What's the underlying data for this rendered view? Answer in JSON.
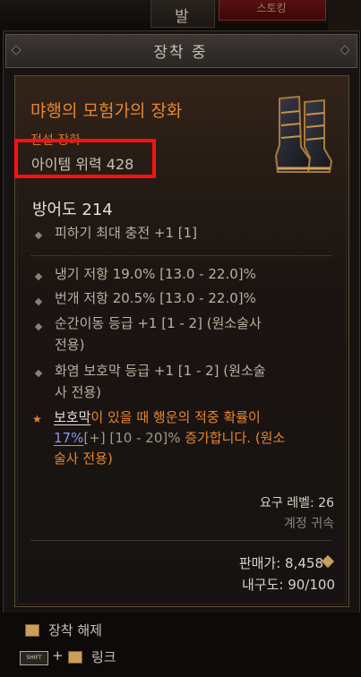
{
  "top": {
    "title": "발",
    "right_tab": "스토킹"
  },
  "equipped_label": "장착 중",
  "item": {
    "name": "먀행의 모험가의 장화",
    "type": "전설 장화",
    "power": "아이템 위력 428",
    "armor": "방어도 214",
    "implicit": "피하기 최대 충전 +1 [1]",
    "affixes": [
      "냉기 저항 19.0% [13.0 - 22.0]%",
      "번개 저항 20.5% [13.0 - 22.0]%",
      "순간이동 등급 +1 [1 - 2] (원소술사",
      "전용)",
      "화염 보호막 등급 +1 [1 - 2] (원소술",
      "사 전용)"
    ],
    "legendary": {
      "keyword": "보호막",
      "text1": "이 있을 때 행운의 적중 확률이",
      "value": "17%",
      "plus": "[+]",
      "range": "[10 - 20]%",
      "text2": "증가합니다. (원소",
      "text3": "술사 전용)"
    },
    "required_level": "요구 레벨: 26",
    "account_bound": "계정 귀속",
    "sell_price": "판매가: 8,458",
    "durability": "내구도: 90/100"
  },
  "actions": {
    "unequip": "장착 해제",
    "shift_key": "SHIFT",
    "plus": "+",
    "link": "링크"
  },
  "colors": {
    "legendary_orange": "#e8852e",
    "highlight_red": "#ff1010",
    "value_blue": "#8c94ee"
  }
}
